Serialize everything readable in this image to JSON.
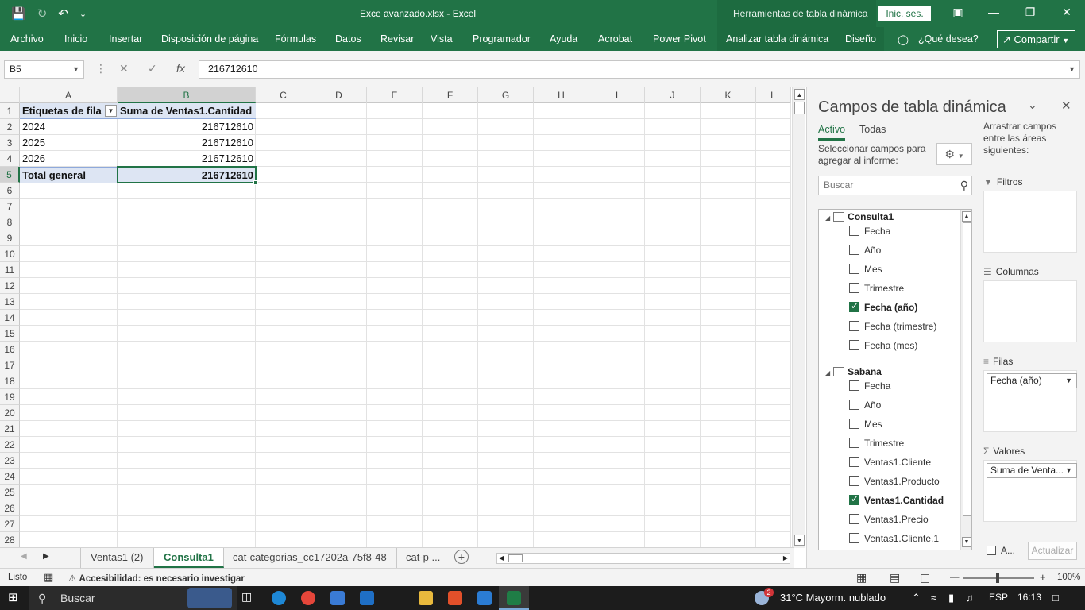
{
  "title_bar": {
    "document_title": "Exce avanzado.xlsx  -  Excel",
    "contextual_title": "Herramientas de tabla dinámica",
    "signin": "Inic. ses.",
    "icons": [
      "save-icon",
      "redo-icon",
      "undo-icon",
      "customize-icon",
      "ribbon-display-icon",
      "minimize-icon",
      "maximize-icon",
      "close-icon"
    ]
  },
  "ribbon": {
    "tabs": [
      "Archivo",
      "Inicio",
      "Insertar",
      "Disposición de página",
      "Fórmulas",
      "Datos",
      "Revisar",
      "Vista",
      "Programador",
      "Ayuda",
      "Acrobat",
      "Power Pivot",
      "Analizar tabla dinámica",
      "Diseño"
    ],
    "tell_me": "¿Qué desea?",
    "share": "Compartir"
  },
  "formula_bar": {
    "name_box": "B5",
    "formula": "216712610"
  },
  "sheet": {
    "columns": [
      "A",
      "B",
      "C",
      "D",
      "E",
      "F",
      "G",
      "H",
      "I",
      "J",
      "K",
      "L"
    ],
    "rows": [
      "1",
      "2",
      "3",
      "4",
      "5",
      "6",
      "7",
      "8",
      "9",
      "10",
      "11",
      "12",
      "13",
      "14",
      "15",
      "16",
      "17",
      "18",
      "19",
      "20",
      "21",
      "22",
      "23",
      "24",
      "25",
      "26",
      "27",
      "28"
    ],
    "pivot": {
      "header_row_label": "Etiquetas de fila",
      "header_value": "Suma de Ventas1.Cantidad",
      "rows": [
        {
          "label": "2024",
          "value": "216712610"
        },
        {
          "label": "2025",
          "value": "216712610"
        },
        {
          "label": "2026",
          "value": "216712610"
        }
      ],
      "total_label": "Total general",
      "total_value": "216712610"
    }
  },
  "sheet_tabs": [
    "Ventas1 (2)",
    "Consulta1",
    "cat-categorias_cc17202a-75f8-48",
    "cat-p ..."
  ],
  "active_sheet": "Consulta1",
  "status_bar": {
    "ready": "Listo",
    "accessibility": "Accesibilidad: es necesario investigar",
    "zoom": "100%"
  },
  "pivot_pane": {
    "title": "Campos de tabla dinámica",
    "tabs": [
      "Activo",
      "Todas"
    ],
    "hint": "Seleccionar campos para agregar al informe:",
    "search_placeholder": "Buscar",
    "drag_hint": "Arrastrar campos entre las áreas siguientes:",
    "groups": [
      {
        "name": "Consulta1",
        "fields": [
          {
            "label": "Fecha",
            "checked": false
          },
          {
            "label": "Año",
            "checked": false
          },
          {
            "label": "Mes",
            "checked": false
          },
          {
            "label": "Trimestre",
            "checked": false
          },
          {
            "label": "Fecha (año)",
            "checked": true
          },
          {
            "label": "Fecha (trimestre)",
            "checked": false
          },
          {
            "label": "Fecha (mes)",
            "checked": false
          }
        ]
      },
      {
        "name": "Sabana",
        "fields": [
          {
            "label": "Fecha",
            "checked": false
          },
          {
            "label": "Año",
            "checked": false
          },
          {
            "label": "Mes",
            "checked": false
          },
          {
            "label": "Trimestre",
            "checked": false
          },
          {
            "label": "Ventas1.Cliente",
            "checked": false
          },
          {
            "label": "Ventas1.Producto",
            "checked": false
          },
          {
            "label": "Ventas1.Cantidad",
            "checked": true
          },
          {
            "label": "Ventas1.Precio",
            "checked": false
          },
          {
            "label": "Ventas1.Cliente.1",
            "checked": false
          }
        ]
      }
    ],
    "areas": {
      "filters": "Filtros",
      "columns": "Columnas",
      "rows": "Filas",
      "rows_item": "Fecha (año)",
      "values": "Valores",
      "values_item": "Suma de Venta..."
    },
    "defer_label": "A...",
    "update_button": "Actualizar"
  },
  "taskbar": {
    "search": "Buscar",
    "weather": "31°C  Mayorm. nublado",
    "weather_badge": "2",
    "lang": "ESP",
    "time": "16:13"
  }
}
